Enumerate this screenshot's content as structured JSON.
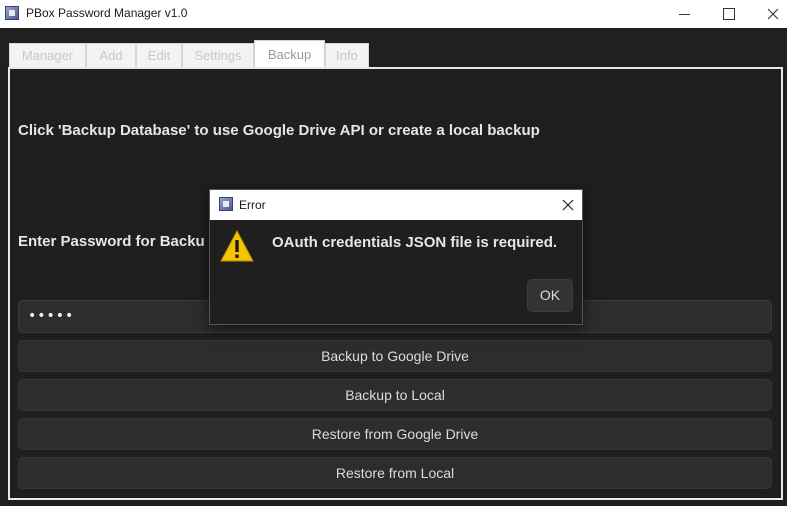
{
  "window": {
    "title": "PBox Password Manager v1.0"
  },
  "tabs": [
    {
      "label": "Manager"
    },
    {
      "label": "Add"
    },
    {
      "label": "Edit"
    },
    {
      "label": "Settings"
    },
    {
      "label": "Backup",
      "active": true
    },
    {
      "label": "Info"
    }
  ],
  "backup": {
    "info_text": "Click 'Backup Database' to use Google Drive API or create a local backup",
    "password_label": "Enter Password for Backu",
    "password_value": "•••••",
    "buttons": {
      "backup_drive": "Backup to Google Drive",
      "backup_local": "Backup to Local",
      "restore_drive": "Restore from Google Drive",
      "restore_local": "Restore from Local"
    }
  },
  "dialog": {
    "title": "Error",
    "message": "OAuth credentials JSON file is required.",
    "ok_label": "OK",
    "icon": "warning-icon"
  },
  "colors": {
    "background": "#1f1f1f",
    "button": "#2d2d2d",
    "text": "#e6e6e6",
    "warning": "#f5c400"
  }
}
